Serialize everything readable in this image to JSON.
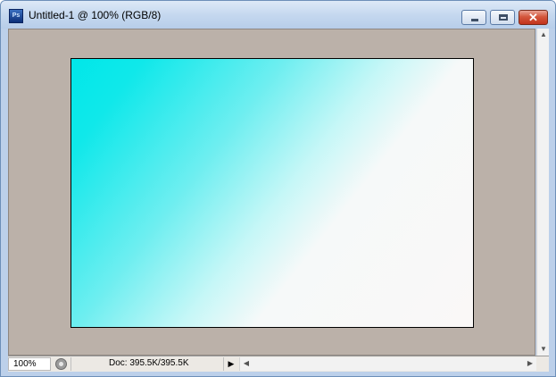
{
  "window": {
    "app_icon_label": "Ps",
    "title": "Untitled-1 @ 100% (RGB/8)",
    "controls": {
      "minimize_icon": "minimize-icon",
      "maximize_icon": "maximize-icon",
      "close_label": "✕"
    }
  },
  "document": {
    "gradient_start_color": "#00e7e9",
    "gradient_end_color": "#faf8f7",
    "pasteboard_color": "#bbb1a9"
  },
  "statusbar": {
    "zoom": "100%",
    "doc_info": "Doc: 395.5K/395.5K",
    "menu_arrow": "▶"
  },
  "scrollbars": {
    "up": "▲",
    "down": "▼",
    "left": "◀",
    "right": "▶"
  }
}
